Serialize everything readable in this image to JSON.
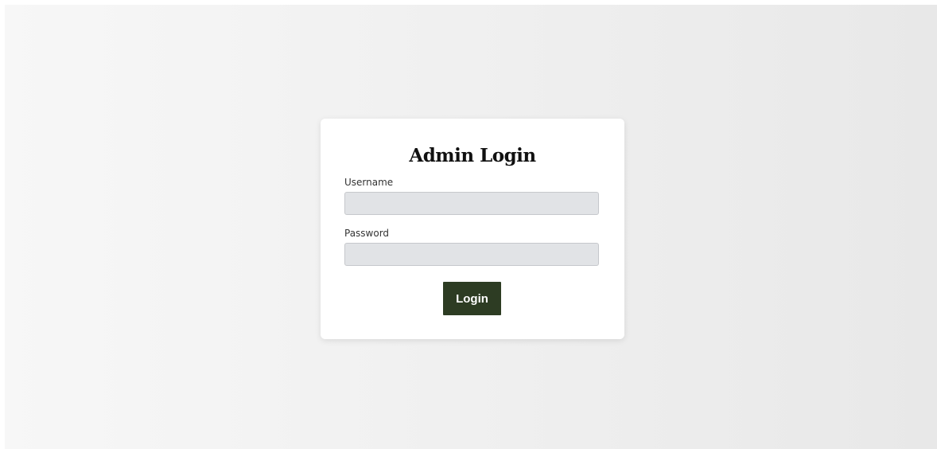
{
  "login": {
    "title": "Admin Login",
    "username_label": "Username",
    "username_value": "",
    "password_label": "Password",
    "password_value": "",
    "button_label": "Login"
  },
  "colors": {
    "button_bg": "#2d3c23",
    "input_bg": "#e1e3e6",
    "card_bg": "#ffffff"
  }
}
